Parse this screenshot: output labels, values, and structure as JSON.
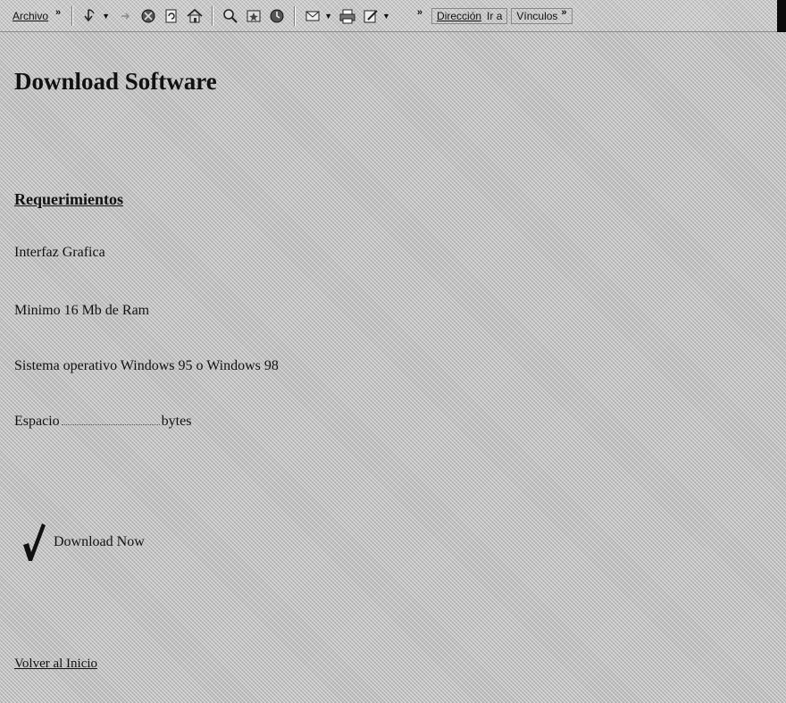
{
  "toolbar": {
    "menu_label": "Archivo",
    "chevron": "»",
    "address_label": "Dirección",
    "goto_label": "Ir a",
    "links_label": "Vínculos",
    "icons": [
      "back-icon",
      "forward-icon",
      "stop-icon",
      "refresh-icon",
      "home-icon",
      "search-icon",
      "favorites-icon",
      "history-icon",
      "mail-icon",
      "print-icon",
      "edit-icon"
    ]
  },
  "page": {
    "title": "Download Software",
    "section_heading": "Requerimientos",
    "requirements": [
      "Interfaz Grafica",
      "Minimo 16 Mb de Ram",
      "Sistema operativo Windows 95 o Windows 98"
    ],
    "space_label": "Espacio",
    "space_unit": "bytes",
    "download_label": "Download Now",
    "back_link": "Volver al Inicio"
  }
}
